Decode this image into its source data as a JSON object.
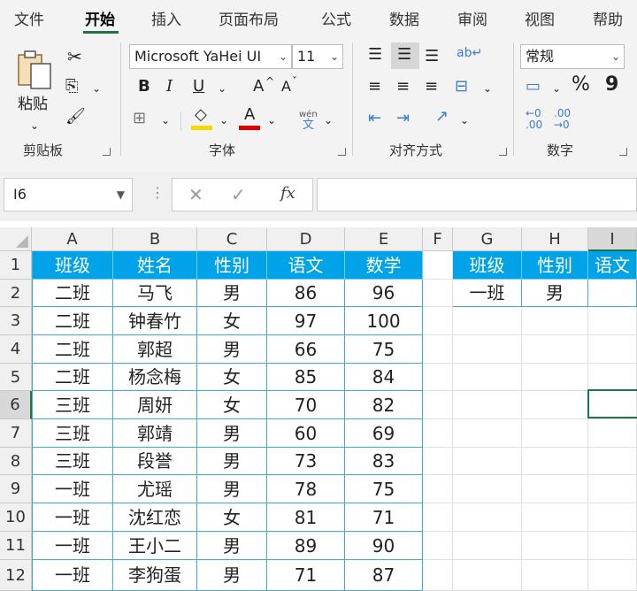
{
  "menu": {
    "items": [
      {
        "label": "文件",
        "key": "file"
      },
      {
        "label": "开始",
        "key": "home"
      },
      {
        "label": "插入",
        "key": "insert"
      },
      {
        "label": "页面布局",
        "key": "layout"
      },
      {
        "label": "公式",
        "key": "formulas"
      },
      {
        "label": "数据",
        "key": "data"
      },
      {
        "label": "审阅",
        "key": "review"
      },
      {
        "label": "视图",
        "key": "view"
      },
      {
        "label": "帮助",
        "key": "help"
      }
    ],
    "active": "开始"
  },
  "ribbon": {
    "clipboard": {
      "paste_label": "粘贴",
      "group_label": "剪贴板"
    },
    "font": {
      "family": "Microsoft YaHei UI",
      "size": "11",
      "group_label": "字体",
      "bold": "B",
      "italic": "I",
      "underline": "U",
      "grow": "A",
      "shrink": "A",
      "phonetic_top": "wén",
      "phonetic_bottom": "文",
      "fill_color": "#ffd700",
      "font_color": "#e00000"
    },
    "alignment": {
      "group_label": "对齐方式"
    },
    "number": {
      "format": "常规",
      "group_label": "数字",
      "percent": "%",
      "comma": "9"
    }
  },
  "formula_bar": {
    "name_box": "I6",
    "content": ""
  },
  "sheet": {
    "columns": [
      "A",
      "B",
      "C",
      "D",
      "E",
      "F",
      "G",
      "H",
      "I"
    ],
    "rows": [
      "1",
      "2",
      "3",
      "4",
      "5",
      "6",
      "7",
      "8",
      "9",
      "10",
      "11",
      "12"
    ],
    "main_table": {
      "headers": [
        "班级",
        "姓名",
        "性别",
        "语文",
        "数学"
      ],
      "rows": [
        [
          "二班",
          "马飞",
          "男",
          "86",
          "96"
        ],
        [
          "二班",
          "钟春竹",
          "女",
          "97",
          "100"
        ],
        [
          "二班",
          "郭超",
          "男",
          "66",
          "75"
        ],
        [
          "二班",
          "杨念梅",
          "女",
          "85",
          "84"
        ],
        [
          "三班",
          "周妍",
          "女",
          "70",
          "82"
        ],
        [
          "三班",
          "郭靖",
          "男",
          "60",
          "69"
        ],
        [
          "三班",
          "段誉",
          "男",
          "73",
          "83"
        ],
        [
          "一班",
          "尤瑶",
          "男",
          "78",
          "75"
        ],
        [
          "一班",
          "沈红恋",
          "女",
          "81",
          "71"
        ],
        [
          "一班",
          "王小二",
          "男",
          "89",
          "90"
        ],
        [
          "一班",
          "李狗蛋",
          "男",
          "71",
          "87"
        ]
      ]
    },
    "criteria_table": {
      "headers": [
        "班级",
        "性别",
        "语文"
      ],
      "row": [
        "一班",
        "男",
        ""
      ]
    },
    "colors": {
      "header_fill": "#00a2e8",
      "selection": "#217346"
    }
  }
}
